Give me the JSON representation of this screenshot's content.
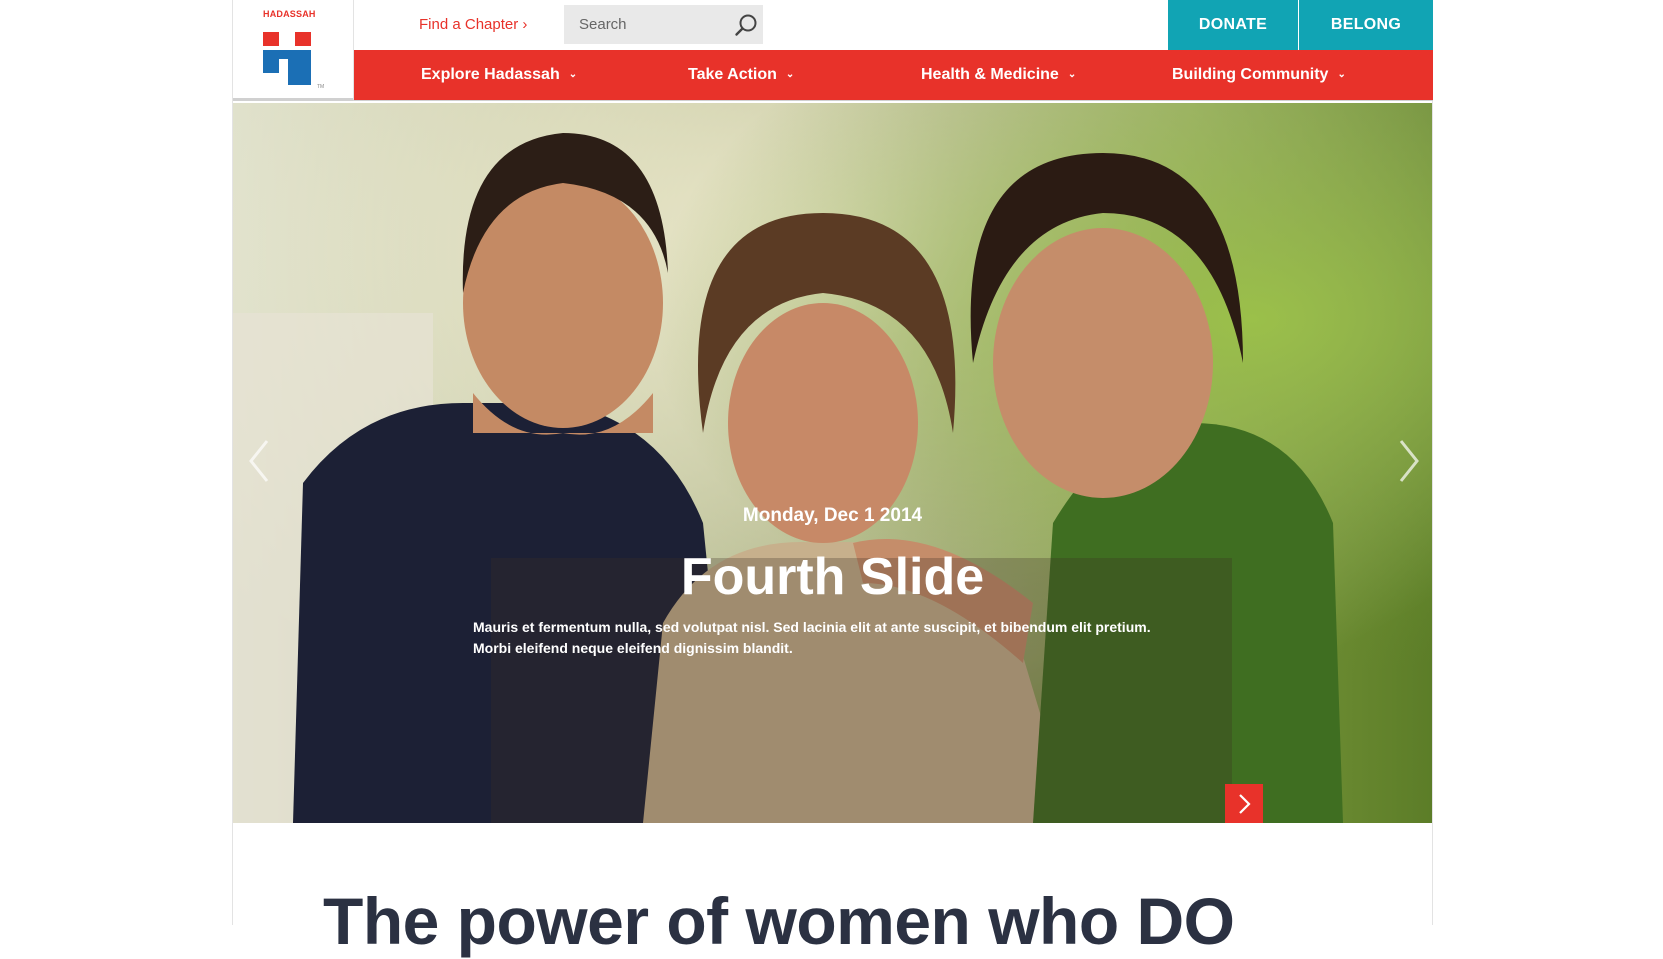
{
  "header": {
    "logo_text": "HADASSAH",
    "logo_tm": "TM",
    "find_chapter": "Find a Chapter ›",
    "search_placeholder": "Search",
    "donate_label": "DONATE",
    "belong_label": "BELONG"
  },
  "nav": {
    "items": [
      {
        "label": "Explore Hadassah"
      },
      {
        "label": "Take Action"
      },
      {
        "label": "Health & Medicine"
      },
      {
        "label": "Building Community"
      }
    ]
  },
  "slide": {
    "date": "Monday, Dec 1 2014",
    "title": "Fourth Slide",
    "body_line1": "Mauris et fermentum nulla, sed volutpat nisl. Sed lacinia elit at ante suscipit, et bibendum elit pretium.",
    "body_line2": "Morbi eleifend neque eleifend dignissim blandit."
  },
  "main": {
    "tagline": "The power of women who DO"
  },
  "colors": {
    "brand_red": "#e8322a",
    "brand_blue": "#1b6fb5",
    "teal": "#11a4b4",
    "text_dark": "#2b3142"
  },
  "icons": {
    "search": "search-icon",
    "chevron": "chevron-down-icon",
    "prev": "chevron-left-icon",
    "next": "chevron-right-icon"
  }
}
